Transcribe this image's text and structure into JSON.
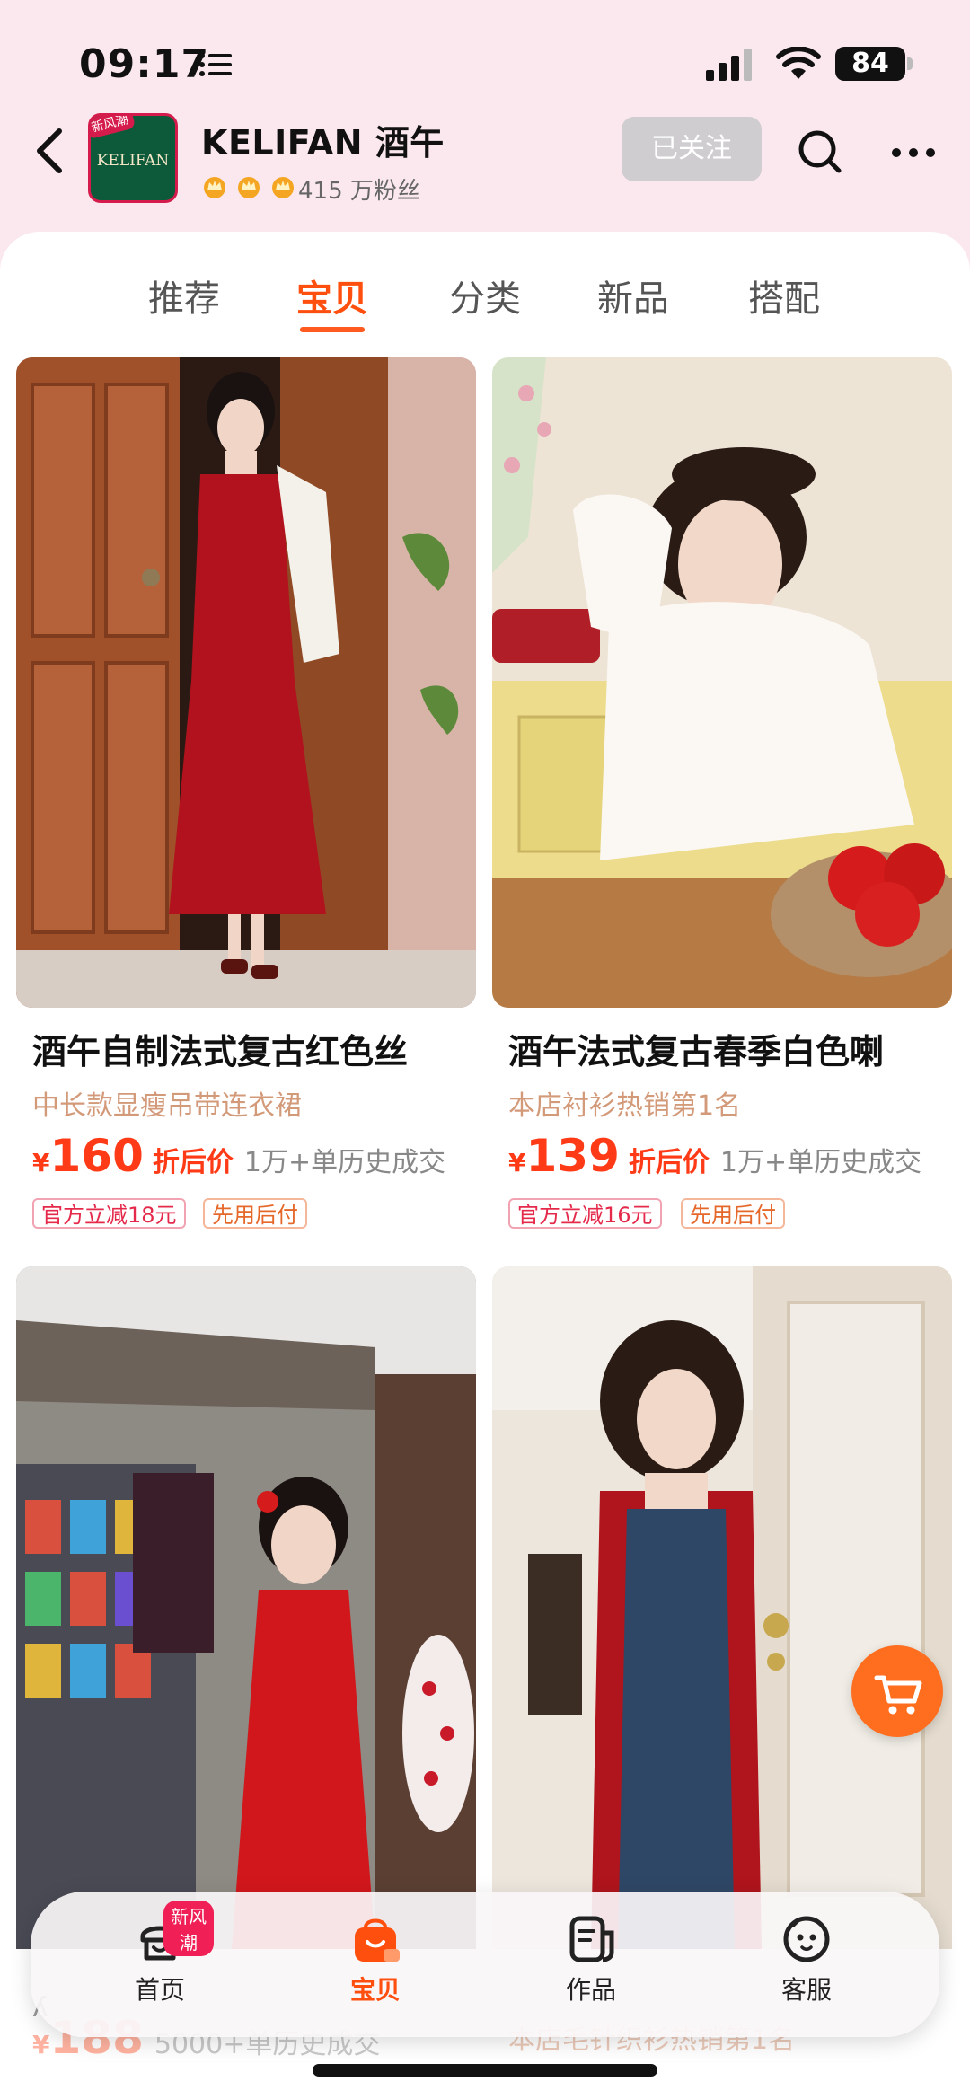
{
  "status": {
    "time": "09:17",
    "battery": "84"
  },
  "shop": {
    "name": "KELIFAN 酒午",
    "logo_text": "KELIFAN",
    "logo_badge": "新风潮",
    "fans": "415 万粉丝",
    "follow_label": "已关注"
  },
  "tabs": [
    {
      "label": "推荐"
    },
    {
      "label": "宝贝"
    },
    {
      "label": "分类"
    },
    {
      "label": "新品"
    },
    {
      "label": "搭配"
    }
  ],
  "active_tab": "宝贝",
  "products": [
    {
      "title": "酒午自制法式复古红色丝",
      "subtitle": "中长款显瘦吊带连衣裙",
      "yen": "¥",
      "price": "160",
      "discount_label": "折后价",
      "sold": "1万+单历史成交",
      "tags": [
        "官方立减18元",
        "先用后付"
      ]
    },
    {
      "title": "酒午法式复古春季白色喇",
      "subtitle": "本店衬衫热销第1名",
      "yen": "¥",
      "price": "139",
      "discount_label": "折后价",
      "sold": "1万+单历史成交",
      "tags": [
        "官方立减16元",
        "先用后付"
      ]
    },
    {
      "title": "ʎ",
      "subtitle": "",
      "yen": "¥",
      "price": "188",
      "discount_label": "",
      "sold": "5000+单历史成交",
      "tags": []
    },
    {
      "title": "",
      "subtitle": "本店毛针织衫热销第1名",
      "yen": "",
      "price": "",
      "discount_label": "",
      "sold": "",
      "tags": []
    }
  ],
  "nav": [
    {
      "label": "首页",
      "icon": "home-icon",
      "badge": "新风潮"
    },
    {
      "label": "宝贝",
      "icon": "bag-icon"
    },
    {
      "label": "作品",
      "icon": "works-icon"
    },
    {
      "label": "客服",
      "icon": "service-icon"
    }
  ],
  "colors": {
    "accent": "#ff4f0e",
    "header_bg": "#fbe8ee",
    "price": "#ff3b17"
  }
}
